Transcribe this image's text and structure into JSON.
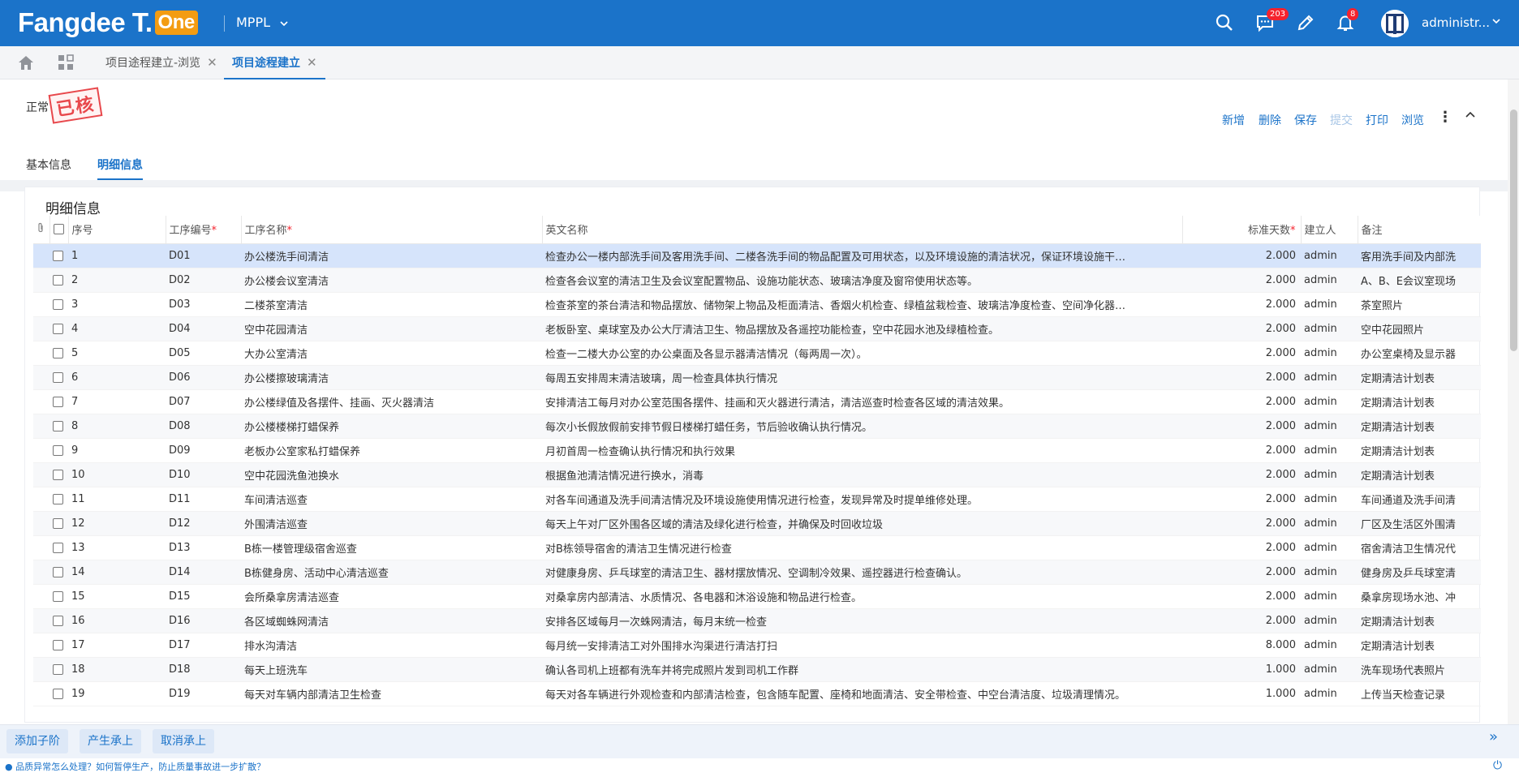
{
  "app": {
    "logo_text": "Fangdee T.",
    "logo_badge": "One",
    "company": "MPPL",
    "username": "administr...",
    "icons": {
      "search": "search-icon",
      "messages": "message-icon",
      "edit": "pencil-icon",
      "notifications": "bell-icon"
    },
    "messages_badge": "203",
    "notifications_badge": "8",
    "brand_color": "#1b73c9"
  },
  "tabs": [
    {
      "label": "项目途程建立-浏览",
      "active": false
    },
    {
      "label": "项目途程建立",
      "active": true
    }
  ],
  "record": {
    "status": "正常",
    "stamp": "已核"
  },
  "toolbar": {
    "new": "新增",
    "delete": "删除",
    "save": "保存",
    "submit": "提交",
    "print": "打印",
    "browse": "浏览"
  },
  "subtabs": [
    "基本信息",
    "明细信息"
  ],
  "panel_title": "明细信息",
  "table": {
    "columns": {
      "seq": "序号",
      "code": "工序编号",
      "name": "工序名称",
      "en_name": "英文名称",
      "days": "标准天数",
      "creator": "建立人",
      "remark": "备注"
    },
    "rows": [
      {
        "seq": "1",
        "code": "D01",
        "name": "办公楼洗手间清洁",
        "desc": "检查办公一楼内部洗手间及客用洗手间、二楼各洗手间的物品配置及可用状态，以及环境设施的清洁状况，保证环境设施干…",
        "days": "2.000",
        "creator": "admin",
        "remark": "客用洗手间及内部洗"
      },
      {
        "seq": "2",
        "code": "D02",
        "name": "办公楼会议室清洁",
        "desc": "检查各会议室的清洁卫生及会议室配置物品、设施功能状态、玻璃洁净度及窗帘使用状态等。",
        "days": "2.000",
        "creator": "admin",
        "remark": "A、B、E会议室现场"
      },
      {
        "seq": "3",
        "code": "D03",
        "name": "二楼茶室清洁",
        "desc": "检查茶室的茶台清洁和物品摆放、储物架上物品及柜面清洁、香烟火机检查、绿植盆栽检查、玻璃洁净度检查、空间净化器…",
        "days": "2.000",
        "creator": "admin",
        "remark": "茶室照片"
      },
      {
        "seq": "4",
        "code": "D04",
        "name": "空中花园清洁",
        "desc": "老板卧室、桌球室及办公大厅清洁卫生、物品摆放及各遥控功能检查，空中花园水池及绿植检查。",
        "days": "2.000",
        "creator": "admin",
        "remark": "空中花园照片"
      },
      {
        "seq": "5",
        "code": "D05",
        "name": "大办公室清洁",
        "desc": "检查一二楼大办公室的办公桌面及各显示器清洁情况（每两周一次）。",
        "days": "2.000",
        "creator": "admin",
        "remark": "办公室桌椅及显示器"
      },
      {
        "seq": "6",
        "code": "D06",
        "name": "办公楼擦玻璃清洁",
        "desc": "每周五安排周末清洁玻璃，周一检查具体执行情况",
        "days": "2.000",
        "creator": "admin",
        "remark": "定期清洁计划表"
      },
      {
        "seq": "7",
        "code": "D07",
        "name": "办公楼绿值及各摆件、挂画、灭火器清洁",
        "desc": "安排清洁工每月对办公室范围各摆件、挂画和灭火器进行清洁，清洁巡查时检查各区域的清洁效果。",
        "days": "2.000",
        "creator": "admin",
        "remark": "定期清洁计划表"
      },
      {
        "seq": "8",
        "code": "D08",
        "name": "办公楼楼梯打蜡保养",
        "desc": "每次小长假放假前安排节假日楼梯打蜡任务，节后验收确认执行情况。",
        "days": "2.000",
        "creator": "admin",
        "remark": "定期清洁计划表"
      },
      {
        "seq": "9",
        "code": "D09",
        "name": "老板办公室家私打蜡保养",
        "desc": "月初首周一检查确认执行情况和执行效果",
        "days": "2.000",
        "creator": "admin",
        "remark": "定期清洁计划表"
      },
      {
        "seq": "10",
        "code": "D10",
        "name": "空中花园洗鱼池换水",
        "desc": "根据鱼池清洁情况进行换水，消毒",
        "days": "2.000",
        "creator": "admin",
        "remark": "定期清洁计划表"
      },
      {
        "seq": "11",
        "code": "D11",
        "name": "车间清洁巡查",
        "desc": "对各车间通道及洗手间清洁情况及环境设施使用情况进行检查，发现异常及时提单维修处理。",
        "days": "2.000",
        "creator": "admin",
        "remark": "车间通道及洗手间清"
      },
      {
        "seq": "12",
        "code": "D12",
        "name": "外围清洁巡查",
        "desc": "每天上午对厂区外围各区域的清洁及绿化进行检查，并确保及时回收垃圾",
        "days": "2.000",
        "creator": "admin",
        "remark": "厂区及生活区外围清"
      },
      {
        "seq": "13",
        "code": "D13",
        "name": "B栋一楼管理级宿舍巡查",
        "desc": "对B栋领导宿舍的清洁卫生情况进行检查",
        "days": "2.000",
        "creator": "admin",
        "remark": "宿舍清洁卫生情况代"
      },
      {
        "seq": "14",
        "code": "D14",
        "name": "B栋健身房、活动中心清洁巡查",
        "desc": "对健康身房、乒乓球室的清洁卫生、器材摆放情况、空调制冷效果、遥控器进行检查确认。",
        "days": "2.000",
        "creator": "admin",
        "remark": "健身房及乒乓球室清"
      },
      {
        "seq": "15",
        "code": "D15",
        "name": "会所桑拿房清洁巡查",
        "desc": "对桑拿房内部清洁、水质情况、各电器和沐浴设施和物品进行检查。",
        "days": "2.000",
        "creator": "admin",
        "remark": "桑拿房现场水池、冲"
      },
      {
        "seq": "16",
        "code": "D16",
        "name": "各区域蜘蛛网清洁",
        "desc": "安排各区域每月一次蛛网清洁，每月末统一检查",
        "days": "2.000",
        "creator": "admin",
        "remark": "定期清洁计划表"
      },
      {
        "seq": "17",
        "code": "D17",
        "name": "排水沟清洁",
        "desc": "每月统一安排清洁工对外围排水沟渠进行清洁打扫",
        "days": "8.000",
        "creator": "admin",
        "remark": "定期清洁计划表"
      },
      {
        "seq": "18",
        "code": "D18",
        "name": "每天上班洗车",
        "desc": "确认各司机上班都有洗车并将完成照片发到司机工作群",
        "days": "1.000",
        "creator": "admin",
        "remark": "洗车现场代表照片"
      },
      {
        "seq": "19",
        "code": "D19",
        "name": "每天对车辆内部清洁卫生检查",
        "desc": "每天对各车辆进行外观检查和内部清洁检查，包含随车配置、座椅和地面清洁、安全带检查、中空台清洁度、垃圾清理情况。",
        "days": "1.000",
        "creator": "admin",
        "remark": "上传当天检查记录"
      }
    ]
  },
  "footer": {
    "add_child": "添加子阶",
    "generate": "产生承上",
    "cancel": "取消承上"
  },
  "bottom_tip": "品质异常怎么处理？如何暂停生产，防止质量事故进一步扩散？"
}
